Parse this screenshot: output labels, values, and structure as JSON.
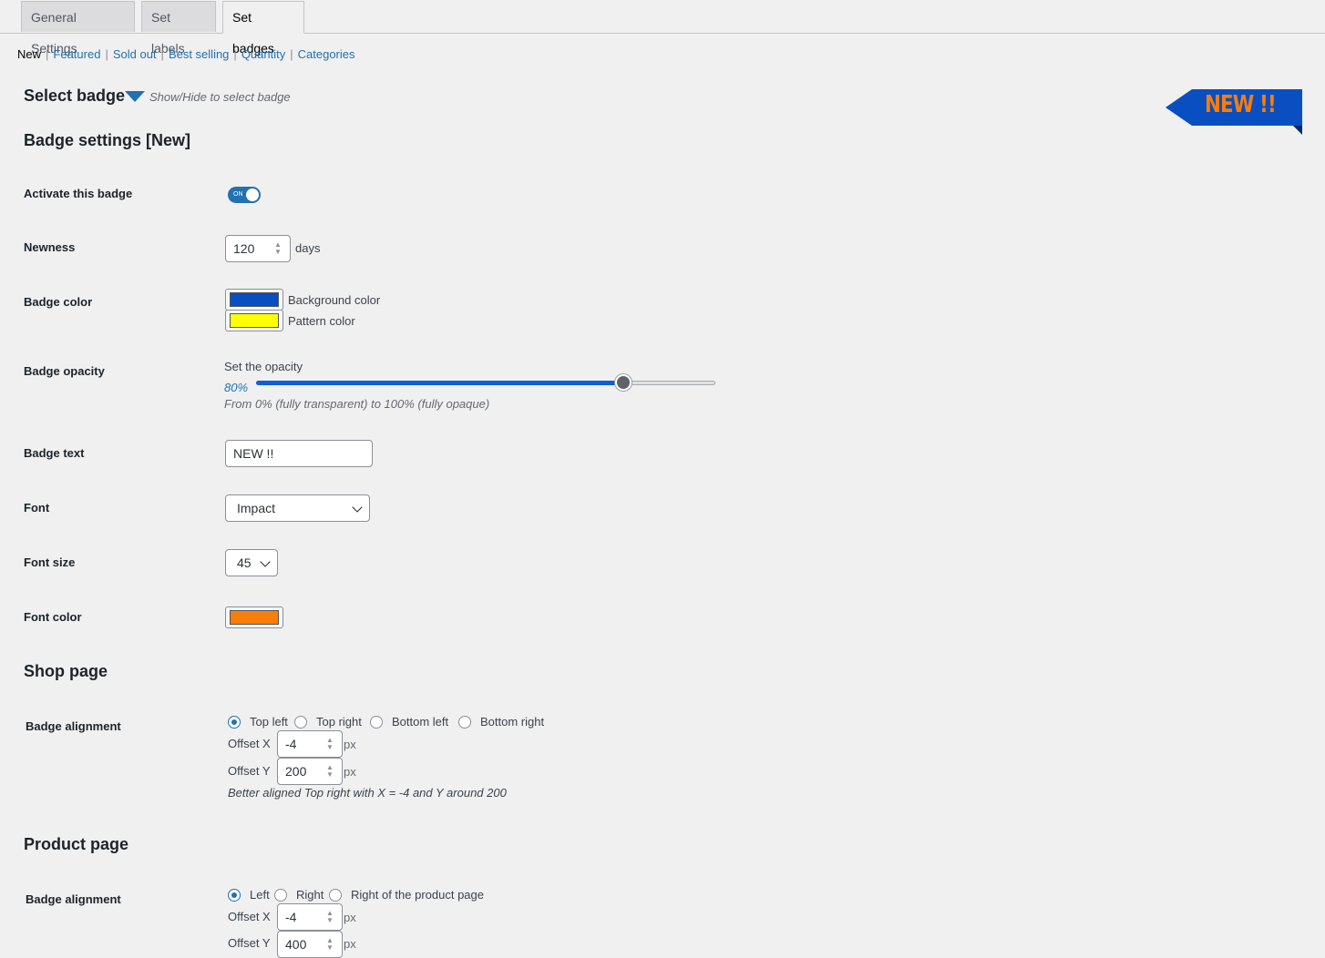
{
  "tabs": [
    {
      "label": "General Settings",
      "active": false
    },
    {
      "label": "Set labels",
      "active": false
    },
    {
      "label": "Set badges",
      "active": true
    }
  ],
  "subnav": {
    "current": "New",
    "links": [
      "Featured",
      "Sold out",
      "Best selling",
      "Quantity",
      "Categories"
    ],
    "separator": "|"
  },
  "select_badge": {
    "title": "Select badge",
    "hint": "Show/Hide to select badge",
    "toggle_icon": "triangle-down-icon"
  },
  "preview": {
    "text": "NEW !!",
    "background_color": "#0a4fc2",
    "text_color": "#f97e09"
  },
  "badge_settings": {
    "title": "Badge settings [New]",
    "activate": {
      "label": "Activate this badge",
      "state_text": "ON",
      "value": true
    },
    "newness": {
      "label": "Newness",
      "value": "120",
      "unit": "days"
    },
    "badge_color": {
      "label": "Badge color",
      "background": {
        "label": "Background color",
        "color": "#0a4fc2"
      },
      "pattern": {
        "label": "Pattern color",
        "color": "#ffff00"
      }
    },
    "opacity": {
      "label": "Badge opacity",
      "caption": "Set the opacity",
      "value_text": "80%",
      "value": 0.8,
      "hint": "From 0% (fully transparent) to 100% (fully opaque)"
    },
    "badge_text": {
      "label": "Badge text",
      "value": "NEW !!"
    },
    "font": {
      "label": "Font",
      "value": "Impact"
    },
    "font_size": {
      "label": "Font size",
      "value": "45"
    },
    "font_color": {
      "label": "Font color",
      "color": "#f97e09"
    }
  },
  "shop_page": {
    "title": "Shop page",
    "alignment": {
      "label": "Badge alignment",
      "options": [
        "Top left",
        "Top right",
        "Bottom left",
        "Bottom right"
      ],
      "selected": "Top left"
    },
    "offset_x": {
      "label": "Offset X",
      "value": "-4",
      "unit": "px"
    },
    "offset_y": {
      "label": "Offset Y",
      "value": "200",
      "unit": "px"
    },
    "hint": "Better aligned Top right with X = -4 and Y around 200"
  },
  "product_page": {
    "title": "Product page",
    "alignment": {
      "label": "Badge alignment",
      "options": [
        "Left",
        "Right",
        "Right of the product page"
      ],
      "selected": "Left"
    },
    "offset_x": {
      "label": "Offset X",
      "value": "-4",
      "unit": "px"
    },
    "offset_y": {
      "label": "Offset Y",
      "value": "400",
      "unit": "px"
    }
  }
}
